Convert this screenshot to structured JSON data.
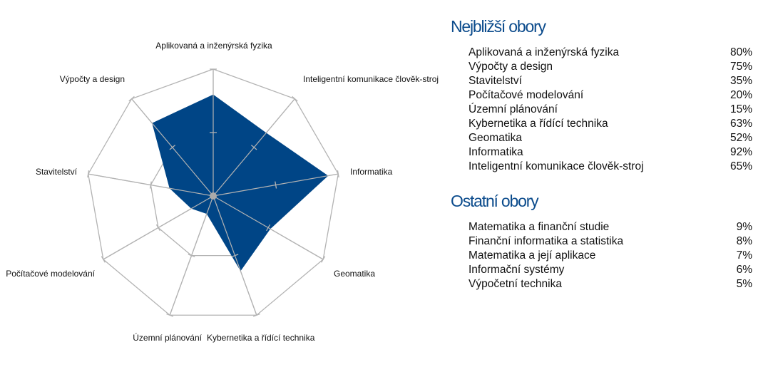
{
  "chart_data": {
    "type": "radar",
    "categories": [
      "Aplikovaná a inženýrská fyzika",
      "Inteligentní komunikace člověk-stroj",
      "Informatika",
      "Geomatika",
      "Kybernetika a řídící technika",
      "Územní plánování",
      "Počítačové modelování",
      "Stavitelství",
      "Výpočty a design"
    ],
    "values": [
      80,
      65,
      92,
      52,
      63,
      15,
      20,
      35,
      75
    ],
    "rlim": [
      0,
      100
    ],
    "grid_levels": [
      50,
      100
    ],
    "fill_color": "#004586",
    "grid_color": "#b3b3b3"
  },
  "closest": {
    "title": "Nejbližší obory",
    "items": [
      {
        "label": "Aplikovaná a inženýrská fyzika",
        "value": "80%"
      },
      {
        "label": "Výpočty a design",
        "value": "75%"
      },
      {
        "label": "Stavitelství",
        "value": "35%"
      },
      {
        "label": "Počítačové modelování",
        "value": "20%"
      },
      {
        "label": "Územní plánování",
        "value": "15%"
      },
      {
        "label": "Kybernetika a řídící technika",
        "value": "63%"
      },
      {
        "label": "Geomatika",
        "value": "52%"
      },
      {
        "label": "Informatika",
        "value": "92%"
      },
      {
        "label": "Inteligentní komunikace člověk-stroj",
        "value": "65%"
      }
    ]
  },
  "other": {
    "title": "Ostatní obory",
    "items": [
      {
        "label": "Matematika a finanční studie",
        "value": "9%"
      },
      {
        "label": "Finanční informatika a statistika",
        "value": "8%"
      },
      {
        "label": "Matematika a její aplikace",
        "value": "7%"
      },
      {
        "label": "Informační systémy",
        "value": "6%"
      },
      {
        "label": "Výpočetní technika",
        "value": "5%"
      }
    ]
  }
}
